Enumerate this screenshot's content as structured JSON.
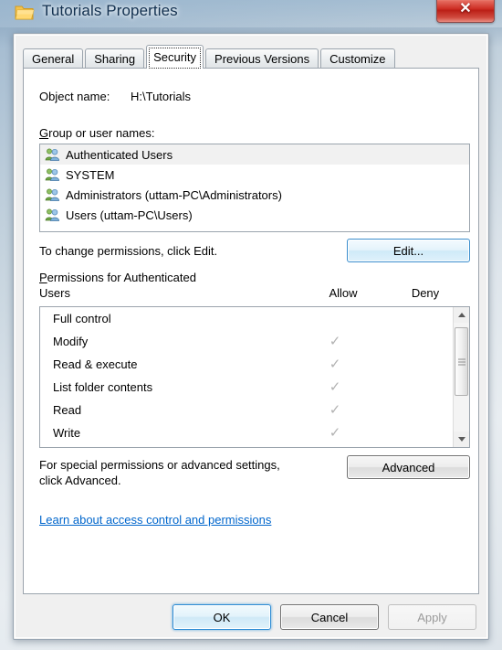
{
  "window": {
    "title": "Tutorials Properties",
    "icon": "folder-icon",
    "close_label": "✕"
  },
  "tabs": [
    {
      "label": "General",
      "active": false
    },
    {
      "label": "Sharing",
      "active": false
    },
    {
      "label": "Security",
      "active": true
    },
    {
      "label": "Previous Versions",
      "active": false
    },
    {
      "label": "Customize",
      "active": false
    }
  ],
  "security": {
    "object_name_label": "Object name:",
    "object_name_value": "H:\\Tutorials",
    "group_list_label": "Group or user names:",
    "groups": [
      {
        "name": "Authenticated Users",
        "selected": true
      },
      {
        "name": "SYSTEM",
        "selected": false
      },
      {
        "name": "Administrators (uttam-PC\\Administrators)",
        "selected": false
      },
      {
        "name": "Users (uttam-PC\\Users)",
        "selected": false
      }
    ],
    "edit_hint": "To change permissions, click Edit.",
    "edit_button": "Edit...",
    "permissions_label_line1": "Permissions for Authenticated",
    "permissions_label_line2": "Users",
    "column_allow": "Allow",
    "column_deny": "Deny",
    "permissions": [
      {
        "name": "Full control",
        "allow": false,
        "deny": false
      },
      {
        "name": "Modify",
        "allow": true,
        "deny": false
      },
      {
        "name": "Read & execute",
        "allow": true,
        "deny": false
      },
      {
        "name": "List folder contents",
        "allow": true,
        "deny": false
      },
      {
        "name": "Read",
        "allow": true,
        "deny": false
      },
      {
        "name": "Write",
        "allow": true,
        "deny": false
      }
    ],
    "check_glyph": "✓",
    "advanced_hint_line1": "For special permissions or advanced settings,",
    "advanced_hint_line2": "click Advanced.",
    "advanced_button": "Advanced",
    "learn_link": "Learn about access control and permissions"
  },
  "footer": {
    "ok": "OK",
    "cancel": "Cancel",
    "apply": "Apply"
  },
  "colors": {
    "link": "#0066cc",
    "title_text": "#12304f",
    "close_red": "#cc2c22",
    "check_grey": "#b2b2b2",
    "default_button_border": "#2c8bd4"
  }
}
